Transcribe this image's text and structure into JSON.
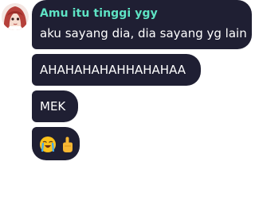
{
  "messages": [
    {
      "sender": "Amu itu tinggi ygy",
      "text": "aku sayang dia, dia sayang yg lain"
    },
    {
      "text": "AHAHAHAHAHHAHAHAA"
    },
    {
      "text": "MEK"
    },
    {
      "emojis": [
        "loudly-crying-face",
        "middle-finger"
      ]
    }
  ],
  "colors": {
    "bubble": "#1f1f33",
    "sender_name": "#5ee3c4",
    "text": "#ffffff"
  },
  "icons": {
    "avatar": "anime-girl-red-hair-avatar"
  }
}
